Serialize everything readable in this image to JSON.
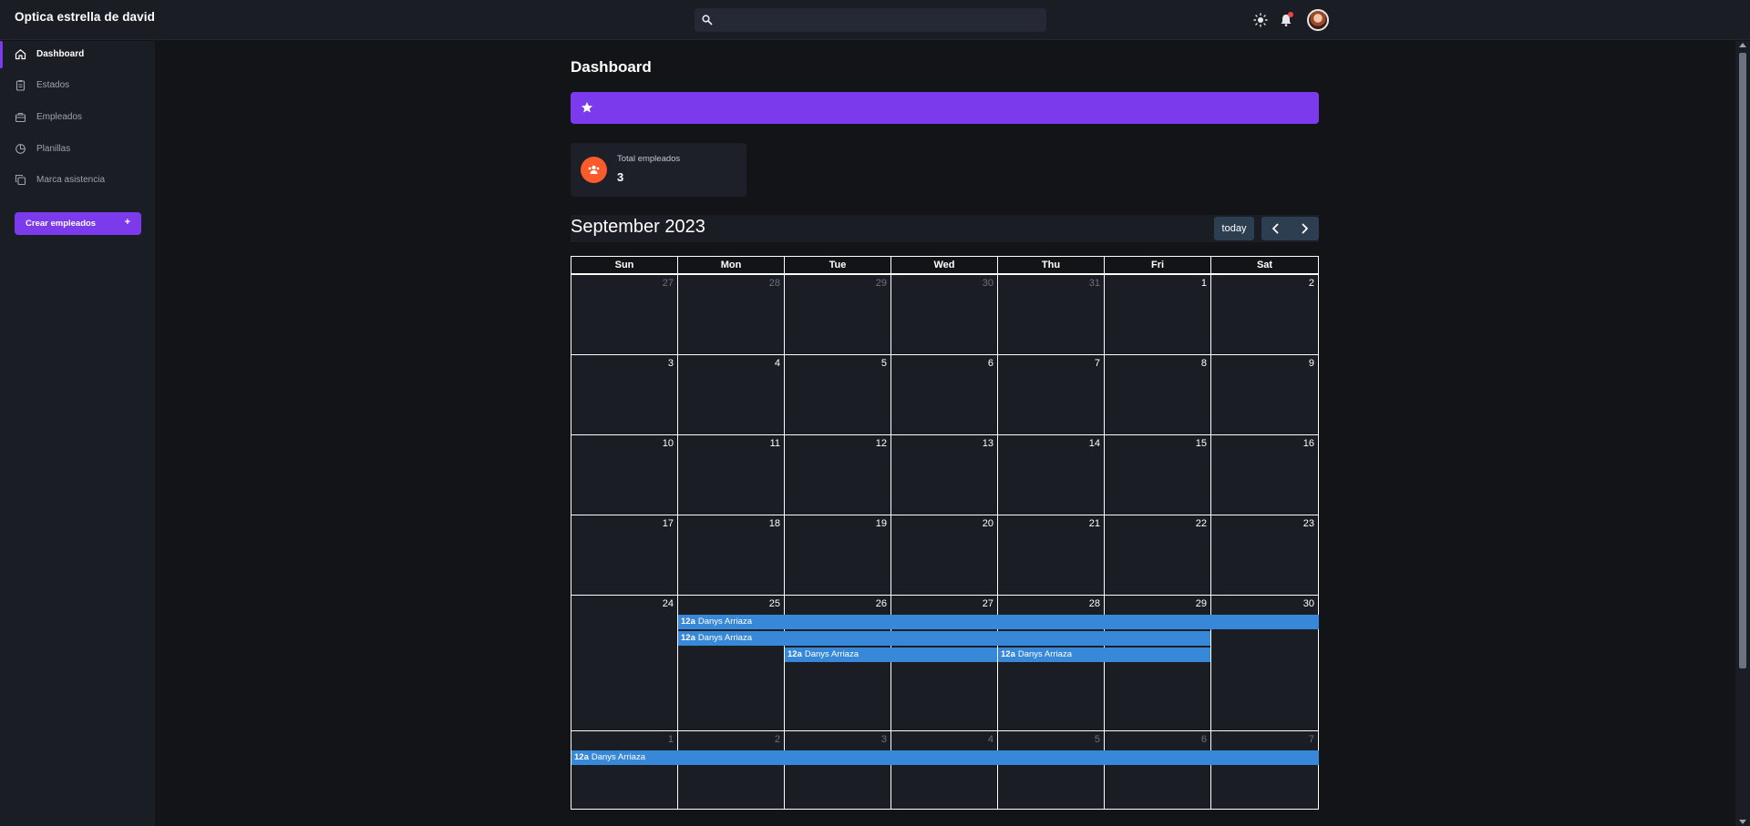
{
  "app": {
    "brand": "Optica estrella de david",
    "search": {
      "placeholder": ""
    },
    "icons": {
      "search": "search-icon",
      "theme": "sun-icon",
      "notifications": "bell-icon",
      "user": "avatar"
    },
    "colors": {
      "accent": "#7c3aed",
      "event": "#3788d8",
      "stat_icon": "#fb5a2a",
      "notification_dot": "#ef4444"
    }
  },
  "sidebar": {
    "items": [
      {
        "label": "Dashboard",
        "icon": "home-icon",
        "active": true
      },
      {
        "label": "Estados",
        "icon": "clipboard-icon",
        "active": false
      },
      {
        "label": "Empleados",
        "icon": "briefcase-icon",
        "active": false
      },
      {
        "label": "Planillas",
        "icon": "pie-chart-icon",
        "active": false
      },
      {
        "label": "Marca asistencia",
        "icon": "copy-icon",
        "active": false
      }
    ],
    "create_button": {
      "label": "Crear empleados",
      "icon": "+"
    }
  },
  "main": {
    "title": "Dashboard",
    "banner": {
      "icon": "star-icon",
      "text": ""
    },
    "stat": {
      "label": "Total empleados",
      "value": "3",
      "icon": "users-icon"
    }
  },
  "calendar": {
    "title": "September 2023",
    "today_label": "today",
    "prev_icon": "chevron-left-icon",
    "next_icon": "chevron-right-icon",
    "weekdays": [
      "Sun",
      "Mon",
      "Tue",
      "Wed",
      "Thu",
      "Fri",
      "Sat"
    ],
    "weeks": [
      [
        {
          "d": "27",
          "o": true
        },
        {
          "d": "28",
          "o": true
        },
        {
          "d": "29",
          "o": true
        },
        {
          "d": "30",
          "o": true
        },
        {
          "d": "31",
          "o": true
        },
        {
          "d": "1",
          "o": false
        },
        {
          "d": "2",
          "o": false
        }
      ],
      [
        {
          "d": "3",
          "o": false
        },
        {
          "d": "4",
          "o": false
        },
        {
          "d": "5",
          "o": false
        },
        {
          "d": "6",
          "o": false
        },
        {
          "d": "7",
          "o": false
        },
        {
          "d": "8",
          "o": false
        },
        {
          "d": "9",
          "o": false
        }
      ],
      [
        {
          "d": "10",
          "o": false
        },
        {
          "d": "11",
          "o": false
        },
        {
          "d": "12",
          "o": false
        },
        {
          "d": "13",
          "o": false
        },
        {
          "d": "14",
          "o": false
        },
        {
          "d": "15",
          "o": false
        },
        {
          "d": "16",
          "o": false
        }
      ],
      [
        {
          "d": "17",
          "o": false
        },
        {
          "d": "18",
          "o": false
        },
        {
          "d": "19",
          "o": false
        },
        {
          "d": "20",
          "o": false
        },
        {
          "d": "21",
          "o": false
        },
        {
          "d": "22",
          "o": false
        },
        {
          "d": "23",
          "o": false
        }
      ],
      [
        {
          "d": "24",
          "o": false
        },
        {
          "d": "25",
          "o": false
        },
        {
          "d": "26",
          "o": false
        },
        {
          "d": "27",
          "o": false
        },
        {
          "d": "28",
          "o": false
        },
        {
          "d": "29",
          "o": false
        },
        {
          "d": "30",
          "o": false
        }
      ],
      [
        {
          "d": "1",
          "o": true
        },
        {
          "d": "2",
          "o": true
        },
        {
          "d": "3",
          "o": true
        },
        {
          "d": "4",
          "o": true
        },
        {
          "d": "5",
          "o": true
        },
        {
          "d": "6",
          "o": true
        },
        {
          "d": "7",
          "o": true
        }
      ]
    ],
    "events": [
      {
        "time": "12a",
        "title": "Danys Arriaza",
        "start": "2023-09-25",
        "end": "2023-09-30"
      },
      {
        "time": "12a",
        "title": "Danys Arriaza",
        "start": "2023-09-25",
        "end": "2023-09-29"
      },
      {
        "time": "12a",
        "title": "Danys Arriaza",
        "start": "2023-09-26",
        "end": "2023-09-27"
      },
      {
        "time": "12a",
        "title": "Danys Arriaza",
        "start": "2023-09-28",
        "end": "2023-09-29"
      },
      {
        "time": "12a",
        "title": "Danys Arriaza",
        "start": "2023-10-01",
        "end": "2023-10-07"
      }
    ]
  }
}
